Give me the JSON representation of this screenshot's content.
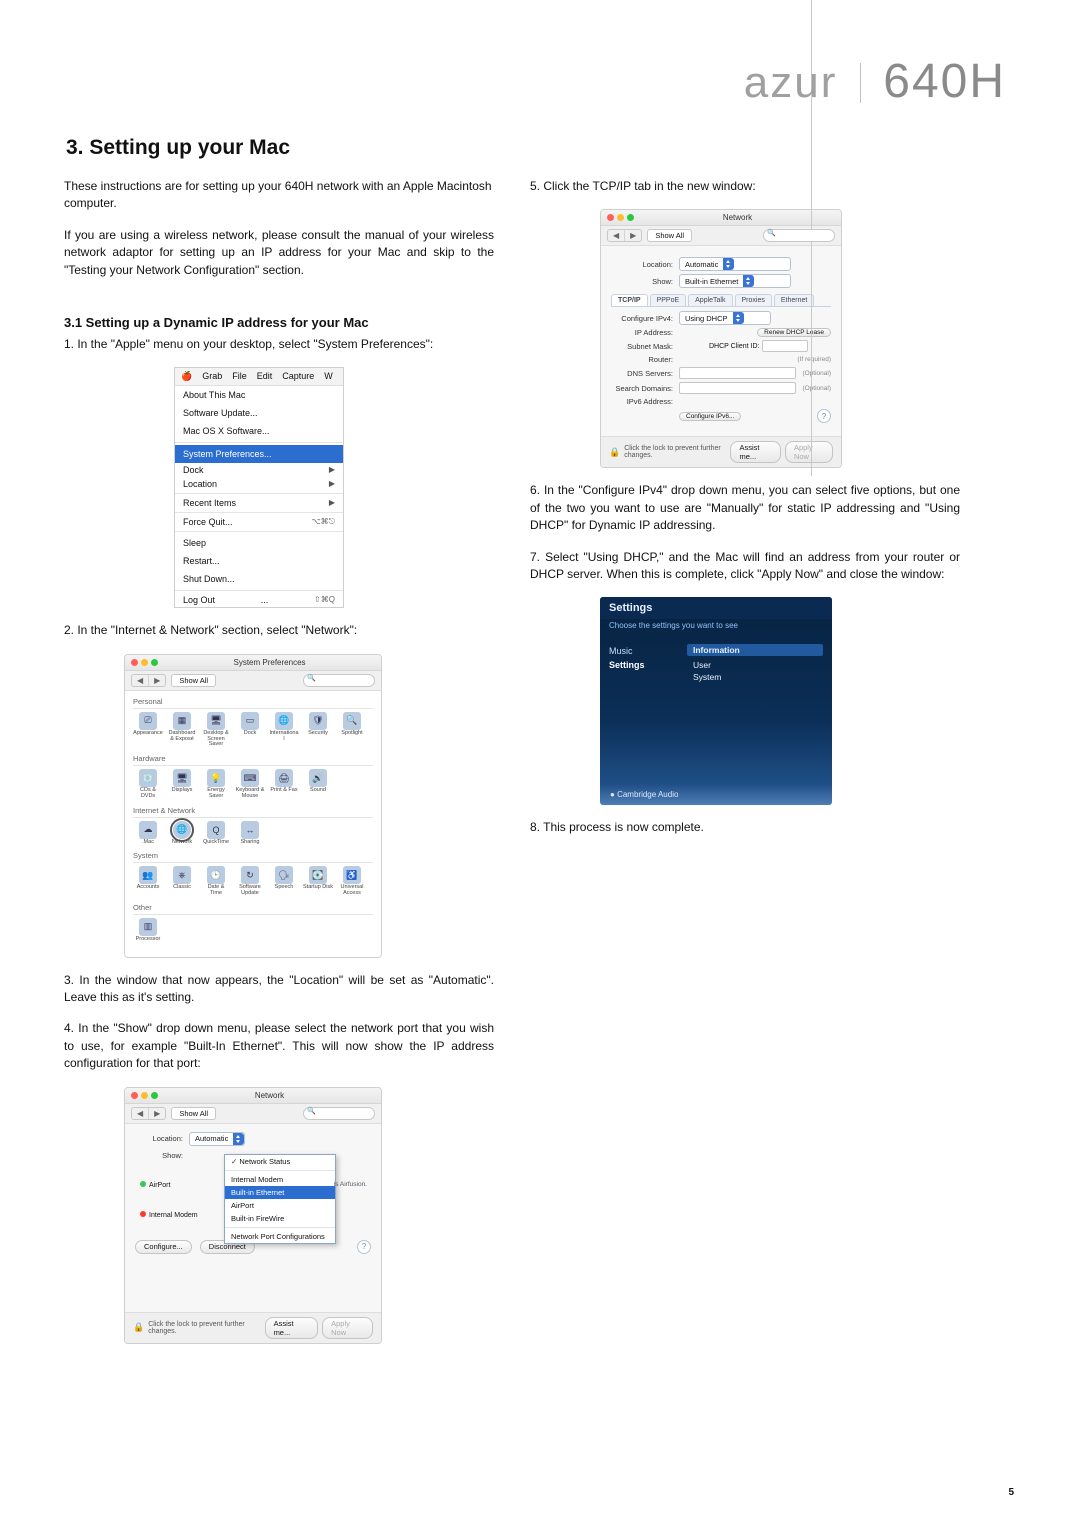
{
  "brand": {
    "azur": "azur",
    "model": "640H"
  },
  "h1": "3. Setting up your Mac",
  "intro1": "These instructions are for setting up your 640H network with an Apple Macintosh computer.",
  "intro2": "If you are using a wireless network, please consult the manual of your wireless network adaptor for setting up an IP address for your Mac and skip to the \"Testing your Network Configuration\" section.",
  "h2": "3.1 Setting up a Dynamic IP address for your Mac",
  "steps": {
    "s1": "1. In the \"Apple\" menu on your desktop, select \"System Preferences\":",
    "s2": "2. In the \"Internet & Network\" section, select \"Network\":",
    "s3": "3. In the window that now appears, the \"Location\" will be set as \"Automatic\". Leave this as it's setting.",
    "s4": "4. In the \"Show\" drop down menu, please select the network port that you wish to use, for example \"Built-In Ethernet\". This will now show the IP address configuration for that port:",
    "s5": "5. Click the TCP/IP tab in the new window:",
    "s6": "6. In the \"Configure IPv4\" drop down menu, you can select five options, but one of the two you want to use are \"Manually\" for static IP addressing and \"Using DHCP\" for Dynamic IP addressing.",
    "s7": "7. Select \"Using DHCP,\" and the Mac will find an address from your router or DHCP server. When this is complete, click \"Apply Now\" and close the window:",
    "s8": "8. This process is now complete."
  },
  "appleMenu": {
    "menubar": [
      "Grab",
      "File",
      "Edit",
      "Capture",
      "W"
    ],
    "top": [
      "About This Mac",
      "Software Update...",
      "Mac OS X Software..."
    ],
    "sysPref": "System Preferences...",
    "dock": "Dock",
    "location": "Location",
    "recent": "Recent Items",
    "forceQuit": "Force Quit...",
    "forceQuitKey": "⌥⌘⎋",
    "power": [
      "Sleep",
      "Restart...",
      "Shut Down..."
    ],
    "logout": "Log Out",
    "logoutKey": "⇧⌘Q"
  },
  "aqua": {
    "showAll": "Show All",
    "navBack": "◀",
    "navFwd": "▶",
    "lockText": "Click the lock to prevent further changes.",
    "assist": "Assist me...",
    "applyNow": "Apply Now"
  },
  "sysPrefs": {
    "title": "System Preferences",
    "sections": [
      {
        "name": "Personal",
        "items": [
          "Appearance",
          "Dashboard & Exposé",
          "Desktop & Screen Saver",
          "Dock",
          "International",
          "Security",
          "Spotlight"
        ]
      },
      {
        "name": "Hardware",
        "items": [
          "CDs & DVDs",
          "Displays",
          "Energy Saver",
          "Keyboard & Mouse",
          "Print & Fax",
          "Sound"
        ]
      },
      {
        "name": "Internet & Network",
        "items": [
          ".Mac",
          "Network",
          "QuickTime",
          "Sharing"
        ]
      },
      {
        "name": "System",
        "items": [
          "Accounts",
          "Classic",
          "Date & Time",
          "Software Update",
          "Speech",
          "Startup Disk",
          "Universal Access"
        ]
      },
      {
        "name": "Other",
        "items": [
          "Processor"
        ]
      }
    ]
  },
  "netWin": {
    "title": "Network",
    "location": "Location:",
    "locationVal": "Automatic",
    "show": "Show:",
    "showDropdown": {
      "tick": "Network Status",
      "items": [
        "Internal Modem",
        "Built-in Ethernet",
        "AirPort",
        "Built-in FireWire"
      ],
      "selected": "Built-in Ethernet",
      "footer": "Network Port Configurations"
    },
    "sideAirport": "AirPort",
    "sideModem": "Internal Modem",
    "airportNote": "is Airfusion.",
    "configure": "Configure...",
    "disconnect": "Disconnect"
  },
  "tcpWin": {
    "title": "Network",
    "location": "Location:",
    "locationVal": "Automatic",
    "show": "Show:",
    "showVal": "Built-in Ethernet",
    "tabs": [
      "TCP/IP",
      "PPPoE",
      "AppleTalk",
      "Proxies",
      "Ethernet"
    ],
    "activeTab": "TCP/IP",
    "configLbl": "Configure IPv4:",
    "configVal": "Using DHCP",
    "ipLbl": "IP Address:",
    "renew": "Renew DHCP Lease",
    "subnetLbl": "Subnet Mask:",
    "clientIdLbl": "DHCP Client ID:",
    "clientIdHint": "(If required)",
    "routerLbl": "Router:",
    "dnsLbl": "DNS Servers:",
    "optional": "(Optional)",
    "searchLbl": "Search Domains:",
    "ipv6Lbl": "IPv6 Address:",
    "cfgIpv6": "Configure IPv6..."
  },
  "dev": {
    "title": "Settings",
    "sub": "Choose the settings you want to see",
    "leftMusic": "Music",
    "leftSettings": "Settings",
    "hdr": "Information",
    "rUser": "User",
    "rSystem": "System",
    "logo": "Cambridge Audio"
  },
  "pageNumber": "5"
}
